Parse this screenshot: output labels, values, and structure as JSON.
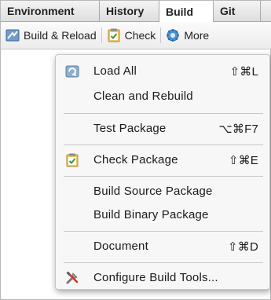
{
  "tabs": [
    {
      "label": "Environment"
    },
    {
      "label": "History"
    },
    {
      "label": "Build"
    },
    {
      "label": "Git"
    }
  ],
  "active_tab": "Build",
  "toolbar": {
    "build_reload_label": "Build & Reload",
    "check_label": "Check",
    "more_label": "More"
  },
  "menu": {
    "load_all": {
      "label": "Load All",
      "shortcut": "⇧⌘L",
      "icon": "load-all-icon"
    },
    "clean_rebuild": {
      "label": "Clean and Rebuild"
    },
    "test_package": {
      "label": "Test Package",
      "shortcut": "⌥⌘F7"
    },
    "check_package": {
      "label": "Check Package",
      "shortcut": "⇧⌘E",
      "icon": "check-clipboard-icon"
    },
    "build_source": {
      "label": "Build Source Package"
    },
    "build_binary": {
      "label": "Build Binary Package"
    },
    "document": {
      "label": "Document",
      "shortcut": "⇧⌘D"
    },
    "configure_tools": {
      "label": "Configure Build Tools...",
      "icon": "tools-icon"
    }
  },
  "colors": {
    "accent_blue": "#4a7fb5",
    "clipboard_orange": "#e8a33b",
    "check_green": "#3a9a3a"
  }
}
